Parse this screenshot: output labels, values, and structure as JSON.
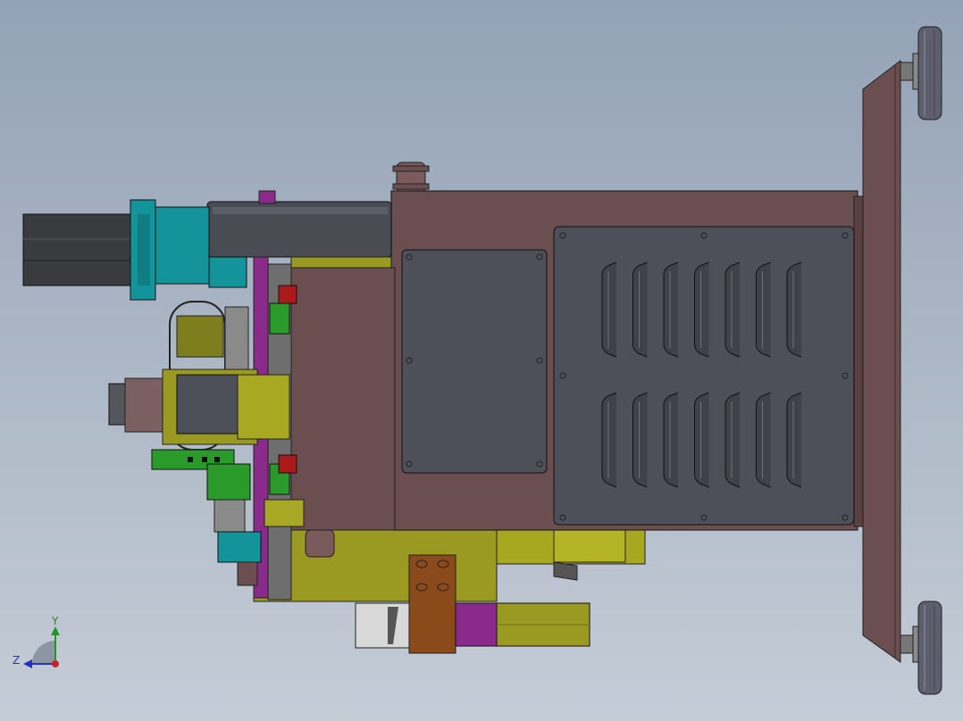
{
  "viewport": {
    "background_top": "#93a2b6",
    "background_bottom": "#c4ccd6"
  },
  "triad": {
    "y_label": "Y",
    "z_label": "Z",
    "y_color": "#1f9a1f",
    "z_color": "#2233cc",
    "x_color": "#cc2222"
  },
  "model": {
    "body_color": "#6b4f50",
    "panel_color": "#4d5058",
    "motor_color": "#3a3b3f",
    "teal_color": "#13949a",
    "olive_color": "#9a9a22",
    "purple_color": "#8a2a8a",
    "green_color": "#2a9a2a",
    "orange_color": "#8a4a1a",
    "wheel_color": "#5e5f6e",
    "vent_rows": 2,
    "vent_columns": 7
  }
}
